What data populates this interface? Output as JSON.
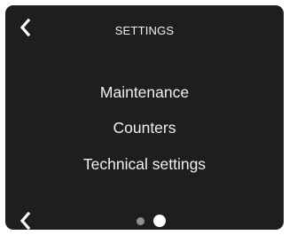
{
  "screen": {
    "title": "SETTINGS",
    "background_color": "#1f1e1e",
    "text_color": "#f0f0f0"
  },
  "navigation": {
    "back_top_icon": "chevron-left-icon",
    "back_bottom_icon": "chevron-left-icon"
  },
  "menu": {
    "items": [
      {
        "label": "Maintenance"
      },
      {
        "label": "Counters"
      },
      {
        "label": "Technical settings"
      }
    ]
  },
  "pagination": {
    "page_count": 2,
    "current_page": 2,
    "inactive_color": "#8f8f8f",
    "active_color": "#ffffff"
  }
}
